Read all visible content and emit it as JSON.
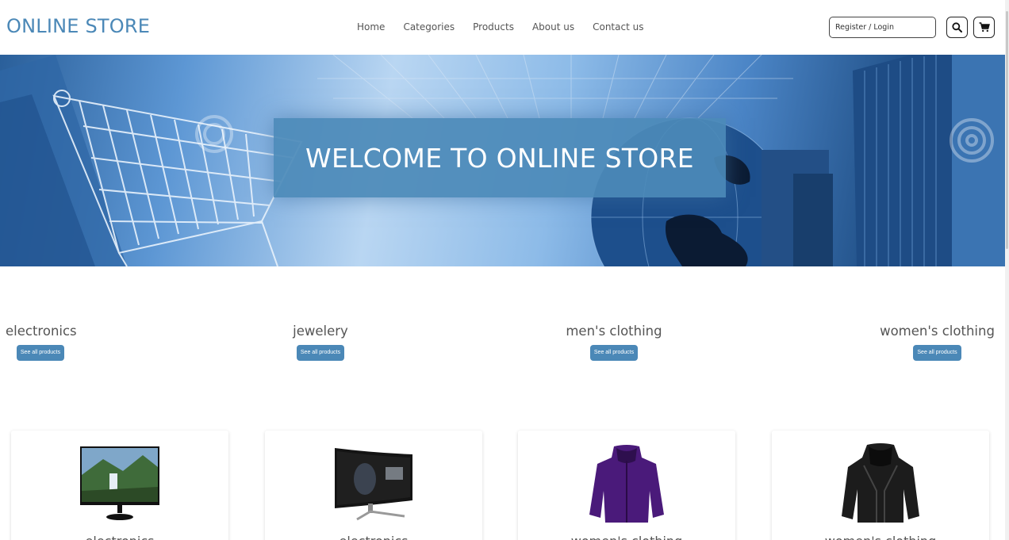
{
  "header": {
    "logo": "ONLINE STORE",
    "nav": [
      "Home",
      "Categories",
      "Products",
      "About us",
      "Contact us"
    ],
    "login_placeholder": "Register / Login",
    "search_icon": "search-icon",
    "cart_icon": "cart-icon"
  },
  "hero": {
    "title": "WELCOME TO ONLINE STORE"
  },
  "categories": [
    {
      "name": "electronics",
      "button": "See all products"
    },
    {
      "name": "jewelery",
      "button": "See all products"
    },
    {
      "name": "men's clothing",
      "button": "See all products"
    },
    {
      "name": "women's clothing",
      "button": "See all products"
    }
  ],
  "products": [
    {
      "image": "monitor-image",
      "category": "electronics"
    },
    {
      "image": "curved-monitor-image",
      "category": "electronics"
    },
    {
      "image": "purple-jacket-image",
      "category": "women's clothing"
    },
    {
      "image": "black-leather-jacket-image",
      "category": "women's clothing"
    }
  ],
  "colors": {
    "accent": "#4b88b7",
    "text": "#555555"
  }
}
